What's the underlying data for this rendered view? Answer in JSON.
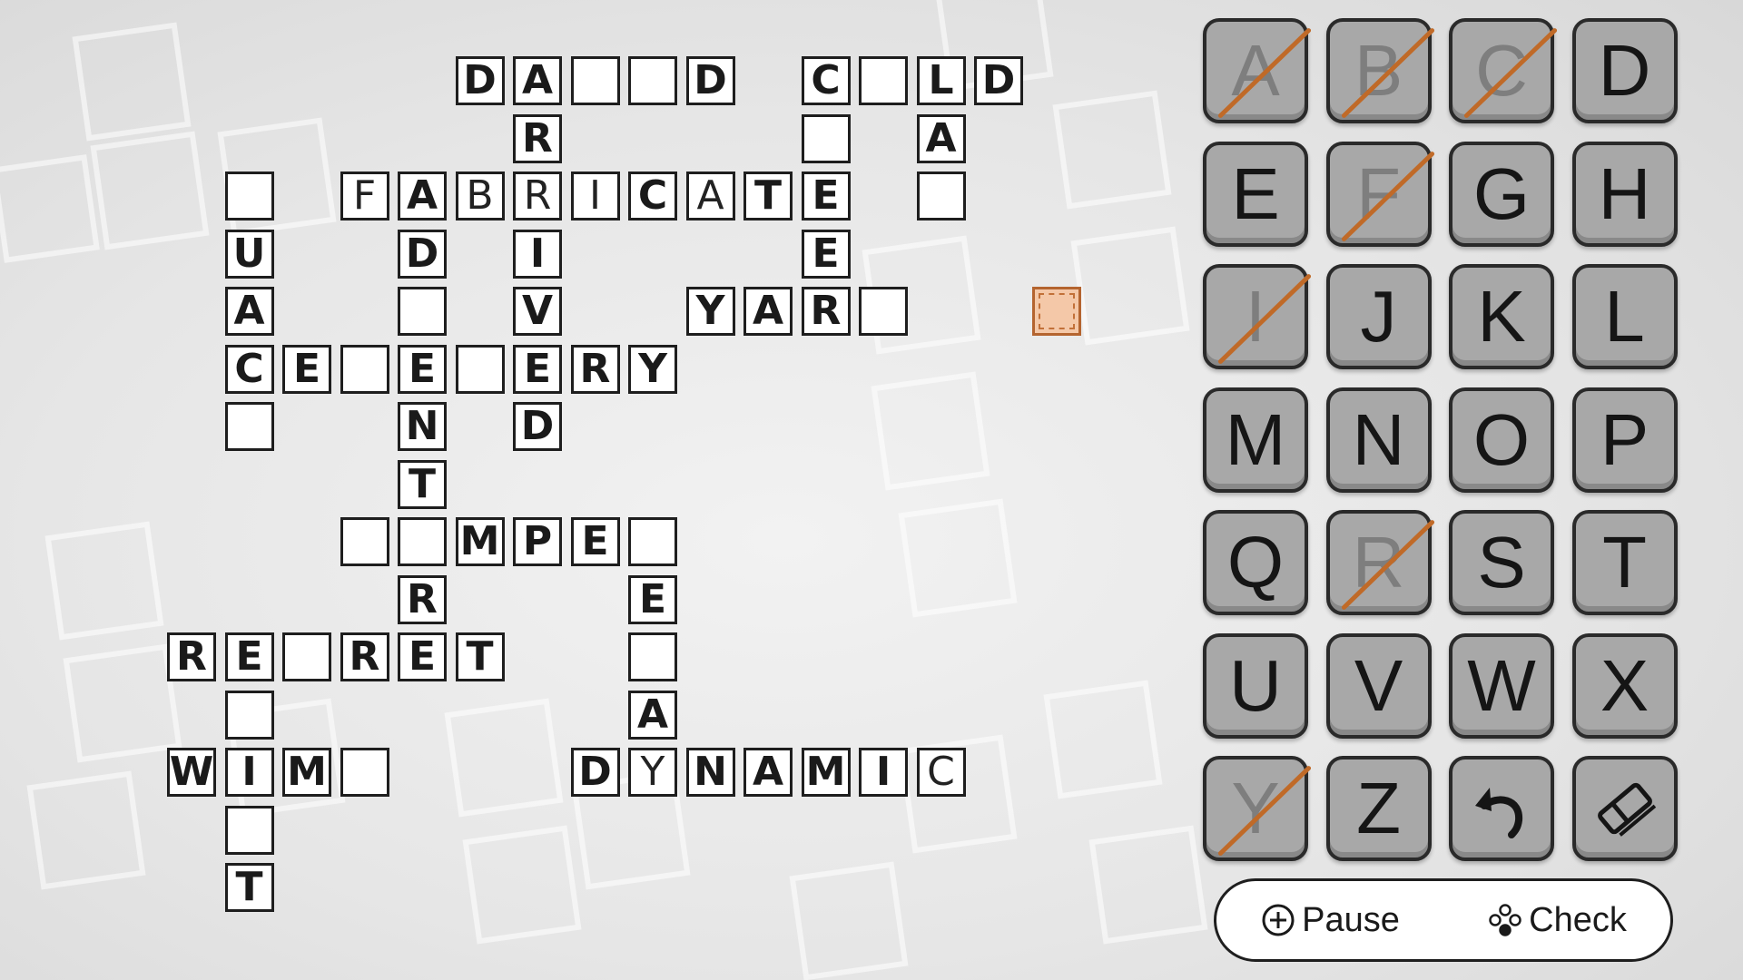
{
  "crossword": {
    "selected_cell": "18,5",
    "cells": [
      [
        "8,1",
        "D",
        true
      ],
      [
        "9,1",
        "A",
        true
      ],
      [
        "10,1",
        "",
        false
      ],
      [
        "11,1",
        "",
        false
      ],
      [
        "12,1",
        "D",
        true
      ],
      [
        "14,1",
        "C",
        true
      ],
      [
        "15,1",
        "",
        false
      ],
      [
        "16,1",
        "L",
        true
      ],
      [
        "17,1",
        "D",
        true
      ],
      [
        "9,2",
        "R",
        true
      ],
      [
        "14,2",
        "",
        false
      ],
      [
        "16,2",
        "A",
        true
      ],
      [
        "4,3",
        "",
        false
      ],
      [
        "6,3",
        "F",
        false
      ],
      [
        "7,3",
        "A",
        true
      ],
      [
        "8,3",
        "B",
        false
      ],
      [
        "9,3",
        "R",
        false
      ],
      [
        "10,3",
        "I",
        false
      ],
      [
        "11,3",
        "C",
        true
      ],
      [
        "12,3",
        "A",
        false
      ],
      [
        "13,3",
        "T",
        true
      ],
      [
        "14,3",
        "E",
        true
      ],
      [
        "16,3",
        "",
        false
      ],
      [
        "4,4",
        "U",
        true
      ],
      [
        "7,4",
        "D",
        true
      ],
      [
        "9,4",
        "I",
        true
      ],
      [
        "14,4",
        "E",
        true
      ],
      [
        "4,5",
        "A",
        true
      ],
      [
        "7,5",
        "",
        false
      ],
      [
        "9,5",
        "V",
        true
      ],
      [
        "12,5",
        "Y",
        true
      ],
      [
        "13,5",
        "A",
        true
      ],
      [
        "14,5",
        "R",
        true
      ],
      [
        "15,5",
        "",
        false
      ],
      [
        "4,6",
        "C",
        true
      ],
      [
        "5,6",
        "E",
        true
      ],
      [
        "6,6",
        "",
        false
      ],
      [
        "7,6",
        "E",
        true
      ],
      [
        "8,6",
        "",
        false
      ],
      [
        "9,6",
        "E",
        true
      ],
      [
        "10,6",
        "R",
        true
      ],
      [
        "11,6",
        "Y",
        true
      ],
      [
        "4,7",
        "",
        false
      ],
      [
        "7,7",
        "N",
        true
      ],
      [
        "9,7",
        "D",
        true
      ],
      [
        "7,8",
        "T",
        true
      ],
      [
        "6,9",
        "",
        false
      ],
      [
        "7,9",
        "",
        false
      ],
      [
        "8,9",
        "M",
        true
      ],
      [
        "9,9",
        "P",
        true
      ],
      [
        "10,9",
        "E",
        true
      ],
      [
        "11,9",
        "",
        false
      ],
      [
        "7,10",
        "R",
        true
      ],
      [
        "11,10",
        "E",
        true
      ],
      [
        "3,11",
        "R",
        true
      ],
      [
        "4,11",
        "E",
        true
      ],
      [
        "5,11",
        "",
        false
      ],
      [
        "6,11",
        "R",
        true
      ],
      [
        "7,11",
        "E",
        true
      ],
      [
        "8,11",
        "T",
        true
      ],
      [
        "11,11",
        "",
        false
      ],
      [
        "4,12",
        "",
        false
      ],
      [
        "11,12",
        "A",
        true
      ],
      [
        "3,13",
        "W",
        true
      ],
      [
        "4,13",
        "I",
        true
      ],
      [
        "5,13",
        "M",
        true
      ],
      [
        "6,13",
        "",
        false
      ],
      [
        "10,13",
        "D",
        true
      ],
      [
        "11,13",
        "Y",
        false
      ],
      [
        "12,13",
        "N",
        true
      ],
      [
        "13,13",
        "A",
        true
      ],
      [
        "14,13",
        "M",
        true
      ],
      [
        "15,13",
        "I",
        true
      ],
      [
        "16,13",
        "C",
        false
      ],
      [
        "4,14",
        "",
        false
      ],
      [
        "4,15",
        "T",
        true
      ]
    ]
  },
  "keyboard": {
    "keys": [
      {
        "label": "A",
        "used": true
      },
      {
        "label": "B",
        "used": true
      },
      {
        "label": "C",
        "used": true
      },
      {
        "label": "D",
        "used": false
      },
      {
        "label": "E",
        "used": false
      },
      {
        "label": "F",
        "used": true
      },
      {
        "label": "G",
        "used": false
      },
      {
        "label": "H",
        "used": false
      },
      {
        "label": "I",
        "used": true
      },
      {
        "label": "J",
        "used": false
      },
      {
        "label": "K",
        "used": false
      },
      {
        "label": "L",
        "used": false
      },
      {
        "label": "M",
        "used": false
      },
      {
        "label": "N",
        "used": false
      },
      {
        "label": "O",
        "used": false
      },
      {
        "label": "P",
        "used": false
      },
      {
        "label": "Q",
        "used": false
      },
      {
        "label": "R",
        "used": true
      },
      {
        "label": "S",
        "used": false
      },
      {
        "label": "T",
        "used": false
      },
      {
        "label": "U",
        "used": false
      },
      {
        "label": "V",
        "used": false
      },
      {
        "label": "W",
        "used": false
      },
      {
        "label": "X",
        "used": false
      },
      {
        "label": "Y",
        "used": true
      },
      {
        "label": "Z",
        "used": false
      },
      {
        "label": "",
        "icon": "undo-icon",
        "used": false
      },
      {
        "label": "",
        "icon": "eraser-icon",
        "used": false
      }
    ]
  },
  "controls": {
    "pause_label": "Pause",
    "pause_icon": "plus-circle-button-icon",
    "check_label": "Check",
    "check_icon": "four-dots-button-icon"
  },
  "colors": {
    "selected_fill": "#f4c8a8",
    "selected_border": "#b4642f",
    "strike": "#c06a28",
    "key_fill": "#a8a8a8"
  }
}
